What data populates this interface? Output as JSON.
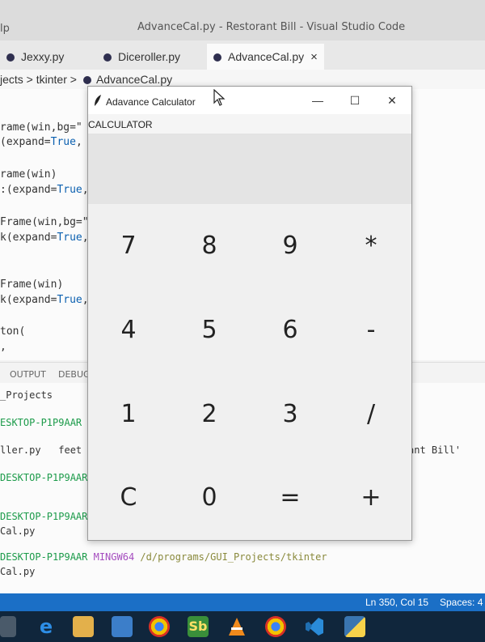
{
  "vscode": {
    "menu_fragment": "lp",
    "window_title": "AdvanceCal.py - Restorant Bill - Visual Studio Code",
    "tabs": [
      {
        "label": "Jexxy.py"
      },
      {
        "label": "Diceroller.py"
      },
      {
        "label": "AdvanceCal.py",
        "close": "×"
      }
    ],
    "breadcrumb": {
      "path": "jects > tkinter >",
      "file": "AdvanceCal.py"
    },
    "code_lines": [
      {
        "prefix": "rame(win,bg=\"",
        "kw": "",
        "rest": ""
      },
      {
        "prefix": "(expand=",
        "kw": "True",
        "rest": ","
      },
      {
        "prefix": "rame(win)",
        "kw": "",
        "rest": ""
      },
      {
        "prefix": ":(expand=",
        "kw": "True",
        "rest": ","
      },
      {
        "prefix": "Frame(win,bg=\"",
        "kw": "",
        "rest": ""
      },
      {
        "prefix": "k(expand=",
        "kw": "True",
        "rest": ","
      },
      {
        "prefix": "Frame(win)",
        "kw": "",
        "rest": ""
      },
      {
        "prefix": "k(expand=",
        "kw": "True",
        "rest": ","
      },
      {
        "prefix": "ton(",
        "kw": "",
        "rest": ""
      },
      {
        "prefix": ",",
        "kw": "",
        "rest": ""
      }
    ],
    "panel_tabs": [
      "OUTPUT",
      "DEBUG"
    ],
    "terminal_lines": [
      "_Projects",
      "ESKTOP-P1P9AAR",
      "ller.py   feet",
      "DESKTOP-P1P9AAR",
      "DESKTOP-P1P9AAR",
      "Cal.py",
      "DESKTOP-P1P9AAR",
      "MINGW64",
      "/d/programs/GUI_Projects/tkinter",
      "Cal.py"
    ],
    "terminal_right_text": "ant Bill'",
    "status": {
      "position": "Ln 350, Col 15",
      "spaces": "Spaces: 4"
    }
  },
  "calculator": {
    "title": "Adavance Calculator",
    "controls": {
      "minimize": "—",
      "maximize": "☐",
      "close": "✕"
    },
    "menu_label": "CALCULATOR",
    "display_value": "",
    "keys": [
      [
        "7",
        "8",
        "9",
        "*"
      ],
      [
        "4",
        "5",
        "6",
        "-"
      ],
      [
        "1",
        "2",
        "3",
        "/"
      ],
      [
        "C",
        "0",
        "=",
        "+"
      ]
    ]
  },
  "taskbar_icons": [
    "microphone-icon",
    "edge-icon",
    "file-explorer-icon",
    "store-icon",
    "chrome-icon",
    "sublime-icon",
    "vlc-icon",
    "chrome-alt-icon",
    "vscode-icon",
    "python-icon"
  ],
  "colors": {
    "status_bar": "#1b6fc6",
    "taskbar": "#10263c",
    "terminal_green": "#1c9b4a"
  }
}
